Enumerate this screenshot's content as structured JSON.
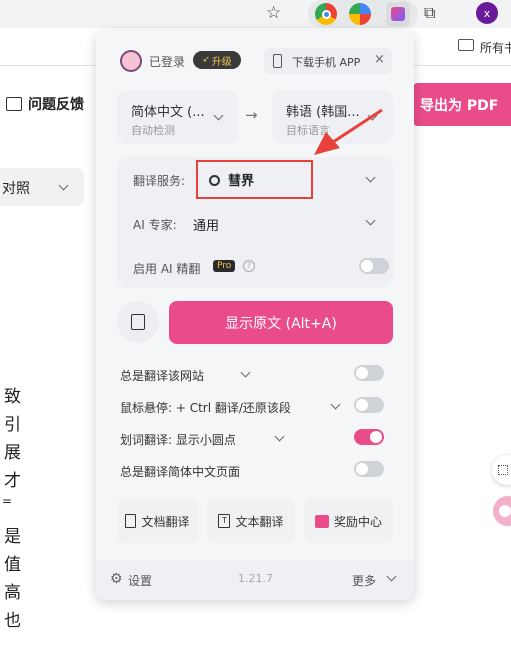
{
  "browser": {
    "bookmark_label": "所有书",
    "profile_initial": "x"
  },
  "page": {
    "feedback_label": "问题反馈",
    "export_label": "导出为 PDF",
    "compare_label": "对照",
    "body_chars": [
      "致",
      "引",
      "展",
      "才",
      "=",
      "是",
      "值",
      "高",
      "也"
    ]
  },
  "popup": {
    "login_status": "已登录",
    "upgrade_label": "升级",
    "download_app_label": "下载手机 APP",
    "source_lang": {
      "label": "简体中文 (...",
      "sub": "自动检测"
    },
    "target_lang": {
      "label": "韩语 (韩国...",
      "sub": "目标语言"
    },
    "translate_service": {
      "label": "翻译服务:",
      "value": "彗界"
    },
    "ai_expert": {
      "label": "AI 专家:",
      "value": "通用"
    },
    "ai_refine": {
      "label": "启用 AI 精翻",
      "badge": "Pro"
    },
    "show_original_button": "显示原文 (Alt+A)",
    "options": [
      {
        "label": "总是翻译该网站",
        "toggle": false
      },
      {
        "label": "鼠标悬停:  + Ctrl 翻译/还原该段",
        "toggle": false
      },
      {
        "label": "划词翻译:  显示小圆点",
        "toggle": true
      },
      {
        "label": "总是翻译简体中文页面",
        "toggle": false
      }
    ],
    "tools": [
      {
        "label": "文档翻译",
        "icon": "document-icon"
      },
      {
        "label": "文本翻译",
        "icon": "text-icon"
      },
      {
        "label": "奖励中心",
        "icon": "gift-icon"
      }
    ],
    "footer": {
      "settings": "设置",
      "version": "1.21.7",
      "more": "更多"
    }
  },
  "colors": {
    "accent": "#ea4c89",
    "highlight_box": "#e8403a"
  }
}
